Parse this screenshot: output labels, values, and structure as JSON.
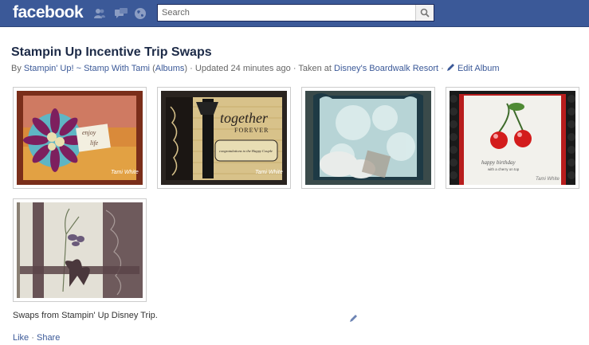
{
  "header": {
    "logo": "facebook",
    "search_placeholder": "Search",
    "brand_color": "#3b5998"
  },
  "album": {
    "title": "Stampin Up Incentive Trip Swaps",
    "by_label": "By",
    "owner": "Stampin' Up! ~ Stamp With Tami",
    "owner_albums_link": "Albums",
    "updated": "Updated 24 minutes ago",
    "taken_at_label": "Taken at",
    "location": "Disney's Boardwalk Resort",
    "edit_label": "Edit Album",
    "separator": "·"
  },
  "photos": [
    {
      "name": "Swap card 1 — purple flower on orange stamped background"
    },
    {
      "name": "Swap card 2 — together forever"
    },
    {
      "name": "Swap card 3 — blue floral with scalloped frame"
    },
    {
      "name": "Swap card 4 — happy birthday cherries"
    },
    {
      "name": "Swap card 5 — iris with ribbon bow"
    }
  ],
  "photo_card_text": {
    "watermark": "Tami White",
    "card1_word1": "enjoy",
    "card1_word2": "life",
    "card2_line1": "together",
    "card2_line2": "FOREVER",
    "card2_small": "congratulations to the Happy Couple",
    "card4_line1": "happy birthday",
    "card4_line2": "with a cherry on top"
  },
  "caption": "Swaps from Stampin' Up Disney Trip.",
  "actions": {
    "like": "Like",
    "share": "Share",
    "separator": "·"
  }
}
